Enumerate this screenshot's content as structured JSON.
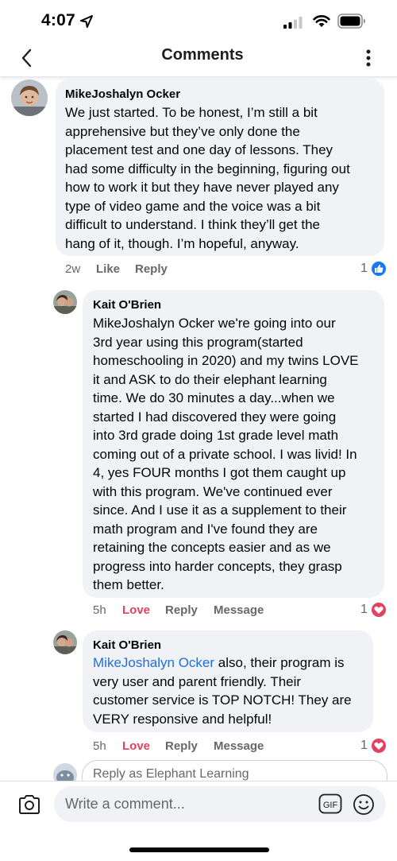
{
  "status": {
    "time": "4:07"
  },
  "header": {
    "title": "Comments"
  },
  "comments": [
    {
      "author": "MikeJoshalyn Ocker",
      "lines": [
        "We just started. To be honest, I’m still a bit",
        "apprehensive but they’ve only done the",
        "placement test and one day of lessons. They",
        "had some difficulty in the beginning, figuring out",
        "how to work it but they have never played any",
        "type of video game and the voice was a bit",
        "difficult to understand. I think they’ll get the",
        "hang of it, though. I’m hopeful, anyway."
      ],
      "time": "2w",
      "like_label": "Like",
      "reply_label": "Reply",
      "reaction_count": "1",
      "reaction": "like"
    },
    {
      "author": "Kait O'Brien",
      "lines": [
        "MikeJoshalyn Ocker we're going into our",
        "3rd year using this program(started",
        "homeschooling in 2020) and my twins LOVE",
        "it and ASK to do their elephant learning",
        "time. We do 30 minutes a day...when we",
        "started I had discovered they were going",
        "into 3rd grade doing 1st grade level math",
        "coming out of a private school. I was livid! In",
        "4, yes FOUR months I got them caught up",
        "with this program. We've continued ever",
        "since. And I use it as a supplement to their",
        "math program and I've found they are",
        "retaining the concepts easier and as we",
        "progress into harder concepts, they grasp",
        "them better."
      ],
      "time": "5h",
      "like_label": "Love",
      "reply_label": "Reply",
      "message_label": "Message",
      "reaction_count": "1",
      "reaction": "love"
    },
    {
      "author": "Kait O'Brien",
      "tag": "MikeJoshalyn Ocker",
      "first_line_rest": " also, their program is",
      "lines": [
        "very user and parent friendly. Their",
        "customer service is TOP NOTCH! They are",
        "VERY responsive and helpful!"
      ],
      "time": "5h",
      "like_label": "Love",
      "reply_label": "Reply",
      "message_label": "Message",
      "reaction_count": "1",
      "reaction": "love"
    }
  ],
  "reply_box": {
    "placeholder": "Reply as Elephant Learning"
  },
  "composer": {
    "placeholder": "Write a comment...",
    "gif_label": "GIF"
  },
  "colors": {
    "like_blue": "#1877f2",
    "love_red": "#e4405f",
    "link_blue": "#216fdb",
    "bubble_gray": "#f0f2f5"
  },
  "icons": [
    "location-arrow-icon",
    "signal-icon",
    "wifi-icon",
    "battery-icon",
    "back-chevron-icon",
    "more-vertical-icon",
    "like-reaction-icon",
    "love-reaction-icon",
    "camera-icon",
    "gif-icon",
    "emoji-icon"
  ]
}
